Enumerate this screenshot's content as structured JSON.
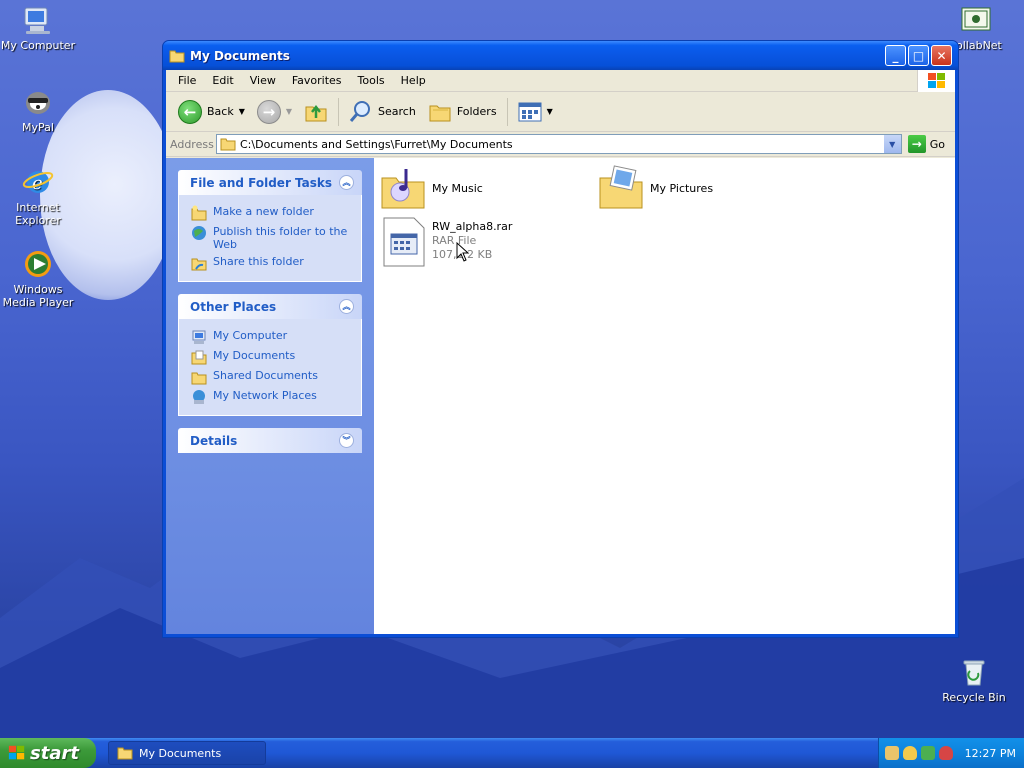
{
  "desktop": {
    "icons": [
      {
        "label": "My Computer",
        "icon": "my-computer-icon"
      },
      {
        "label": "MyPal",
        "icon": "mypal-icon"
      },
      {
        "label": "Internet Explorer",
        "icon": "internet-explorer-icon"
      },
      {
        "label": "Windows Media Player",
        "icon": "media-player-icon"
      },
      {
        "label": "ollabNet",
        "icon": "collabnet-icon"
      },
      {
        "label": "Recycle Bin",
        "icon": "recycle-bin-icon"
      }
    ]
  },
  "window": {
    "title": "My Documents",
    "menu": [
      "File",
      "Edit",
      "View",
      "Favorites",
      "Tools",
      "Help"
    ],
    "toolbar": {
      "back": "Back",
      "search": "Search",
      "folders": "Folders"
    },
    "address": {
      "label": "Address",
      "value": "C:\\Documents and Settings\\Furret\\My Documents",
      "go": "Go"
    },
    "tasks": {
      "title": "File and Folder Tasks",
      "items": [
        "Make a new folder",
        "Publish this folder to the Web",
        "Share this folder"
      ]
    },
    "other_places": {
      "title": "Other Places",
      "items": [
        "My Computer",
        "My Documents",
        "Shared Documents",
        "My Network Places"
      ]
    },
    "details": {
      "title": "Details"
    },
    "files": [
      {
        "name": "My Music",
        "icon": "music-folder-icon"
      },
      {
        "name": "My Pictures",
        "icon": "pictures-folder-icon"
      },
      {
        "name": "RW_alpha8.rar",
        "type": "RAR File",
        "size": "107,1 2 KB",
        "icon": "rar-file-icon"
      }
    ]
  },
  "taskbar": {
    "start": "start",
    "task": "My Documents",
    "clock": "12:27 PM"
  },
  "colors": {
    "link": "#215dc6",
    "titlebar": "#0a56e3",
    "taskbar": "#245edb",
    "start": "#3c9a3a"
  }
}
